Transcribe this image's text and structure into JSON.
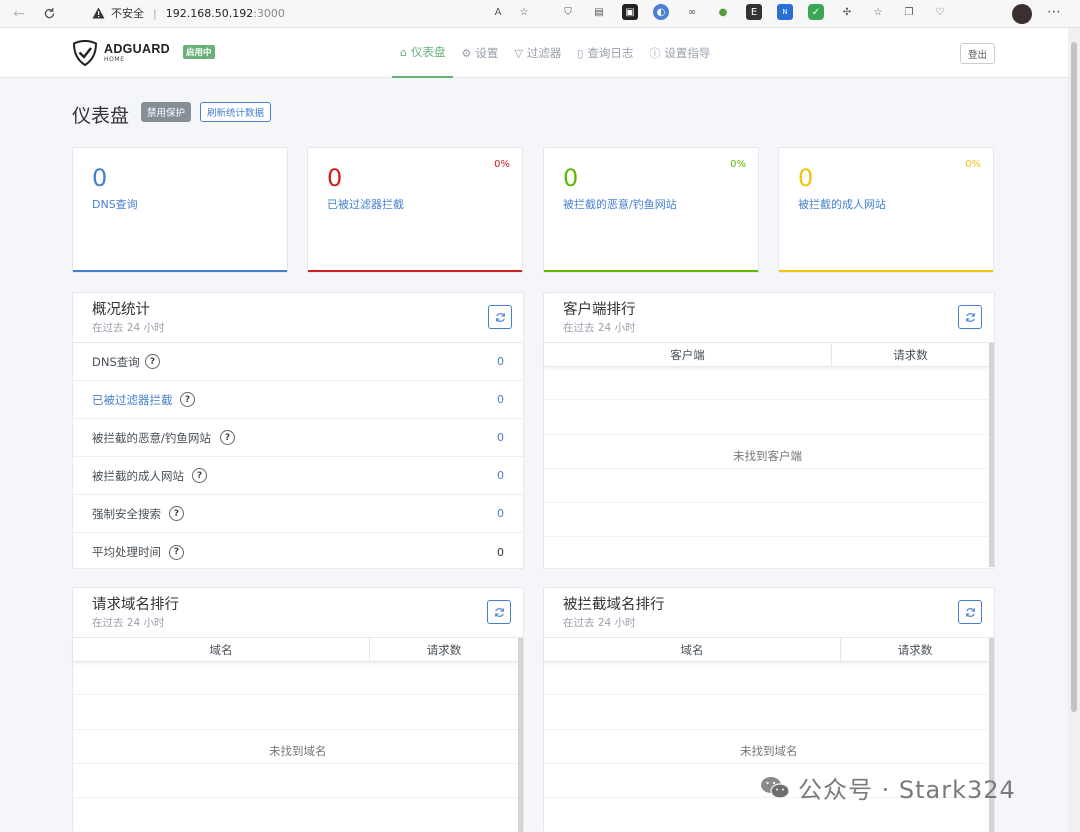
{
  "browser": {
    "security_label": "不安全",
    "url_host": "192.168.50.192",
    "url_port": ":3000"
  },
  "app": {
    "brand": "ADGUARD",
    "brand_sub": "HOME",
    "status_badge": "启用中",
    "nav": [
      {
        "label": "仪表盘",
        "icon": "home-icon",
        "active": true
      },
      {
        "label": "设置",
        "icon": "gear-icon",
        "active": false
      },
      {
        "label": "过滤器",
        "icon": "filter-icon",
        "active": false
      },
      {
        "label": "查询日志",
        "icon": "document-icon",
        "active": false
      },
      {
        "label": "设置指导",
        "icon": "help-icon",
        "active": false
      }
    ],
    "logout_label": "登出",
    "accent_color": "#67b279"
  },
  "dashboard": {
    "title": "仪表盘",
    "disable_button": "禁用保护",
    "refresh_button": "刷新统计数据"
  },
  "stat_cards": [
    {
      "value": "0",
      "label": "DNS查询",
      "percent": "",
      "color": "#467fcf"
    },
    {
      "value": "0",
      "label": "已被过滤器拦截",
      "percent": "0%",
      "color": "#cd201f"
    },
    {
      "value": "0",
      "label": "被拦截的恶意/钓鱼网站",
      "percent": "0%",
      "color": "#5eba00"
    },
    {
      "value": "0",
      "label": "被拦截的成人网站",
      "percent": "0%",
      "color": "#f1c40f"
    }
  ],
  "overview": {
    "title": "概况统计",
    "subtitle": "在过去 24 小时",
    "rows": [
      {
        "label": "DNS查询",
        "value": "0"
      },
      {
        "label": "已被过滤器拦截",
        "value": "0"
      },
      {
        "label": "被拦截的恶意/钓鱼网站",
        "value": "0"
      },
      {
        "label": "被拦截的成人网站",
        "value": "0"
      },
      {
        "label": "强制安全搜索",
        "value": "0"
      },
      {
        "label": "平均处理时间",
        "value": "0"
      }
    ],
    "help_glyph": "?"
  },
  "clients": {
    "title": "客户端排行",
    "subtitle": "在过去 24 小时",
    "col1": "客户端",
    "col2": "请求数",
    "empty": "未找到客户端"
  },
  "queried_domains": {
    "title": "请求域名排行",
    "subtitle": "在过去 24 小时",
    "col1": "域名",
    "col2": "请求数",
    "empty": "未找到域名"
  },
  "blocked_domains": {
    "title": "被拦截域名排行",
    "subtitle": "在过去 24 小时",
    "col1": "域名",
    "col2": "请求数",
    "empty": "未找到域名"
  },
  "watermark": "公众号 · Stark324"
}
